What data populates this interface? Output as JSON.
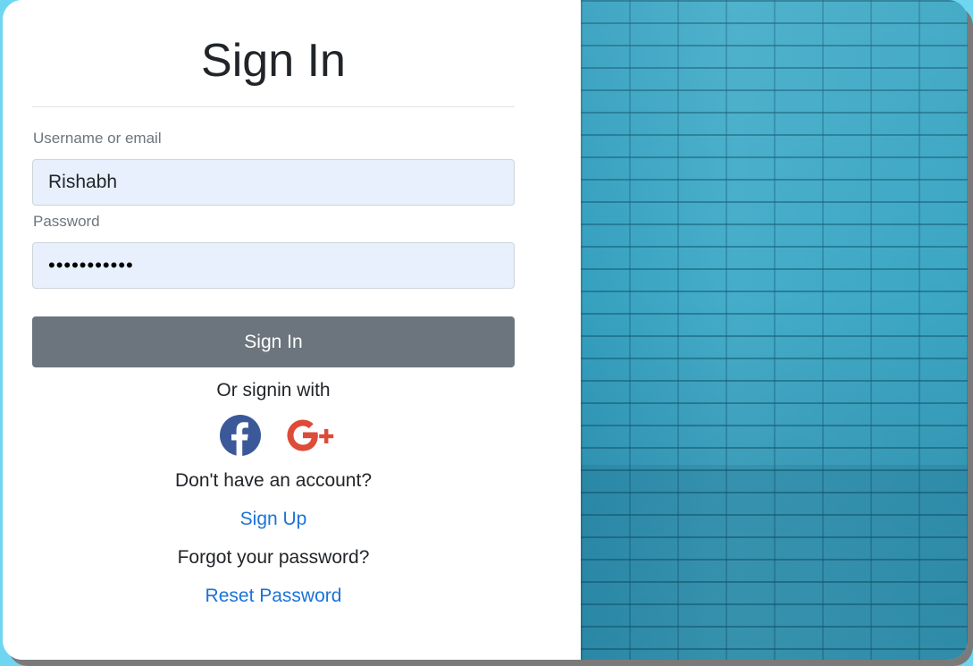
{
  "page": {
    "title": "Sign In"
  },
  "form": {
    "username_label": "Username or email",
    "username_value": "Rishabh",
    "password_label": "Password",
    "password_value": "•••••••••••",
    "submit_label": "Sign In"
  },
  "social": {
    "prompt": "Or signin with",
    "providers": [
      "facebook-icon",
      "google-plus-icon"
    ],
    "facebook_color": "#3b5998",
    "google_color": "#dd4b39"
  },
  "links": {
    "no_account_text": "Don't have an account?",
    "signup_label": "Sign Up",
    "forgot_text": "Forgot your password?",
    "reset_label": "Reset Password"
  },
  "colors": {
    "page_background": "#6fd6f2",
    "button": "#6c757d",
    "link": "#1a73d9",
    "input_fill": "#e8f0fe",
    "panel_image": "#3aa3c0"
  }
}
